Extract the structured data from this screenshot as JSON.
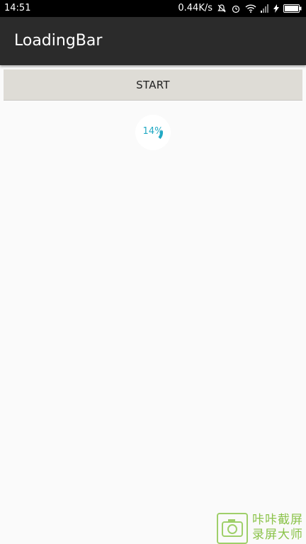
{
  "status_bar": {
    "time": "14:51",
    "network_speed": "0.44K/s"
  },
  "app_bar": {
    "title": "LoadingBar"
  },
  "start_button": {
    "label": "START"
  },
  "progress": {
    "percent_text": "14%",
    "value": 0.14,
    "color": "#22a9c4"
  },
  "watermark": {
    "line1": "咔咔截屏",
    "line2": "录屏大师",
    "color": "#8bc34a"
  }
}
